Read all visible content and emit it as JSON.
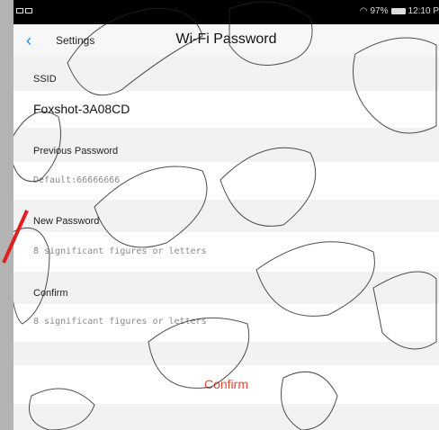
{
  "status_bar": {
    "battery": "97%",
    "time": "12:10 P"
  },
  "nav": {
    "back_label": "Settings",
    "title": "Wi-Fi Password"
  },
  "ssid": {
    "label": "SSID",
    "value": "Foxshot-3A08CD"
  },
  "previous_password": {
    "label": "Previous Password",
    "value": "Default:66666666"
  },
  "new_password": {
    "label": "New Password",
    "placeholder": "8 significant figures or letters"
  },
  "confirm_password": {
    "label": "Confirm",
    "placeholder": "8 significant figures or letters"
  },
  "confirm_button": {
    "label": "Confirm"
  },
  "colors": {
    "accent_red": "#e8483c",
    "back_blue": "#0a84ff"
  }
}
